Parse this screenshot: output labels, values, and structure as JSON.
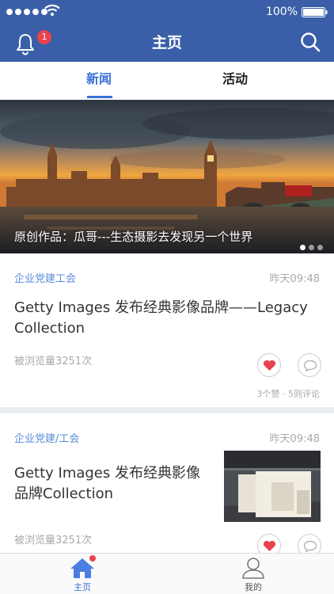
{
  "status_bar": {
    "battery_text": "100%",
    "signal_icon": "signal-dots-icon",
    "wifi_icon": "wifi-icon",
    "battery_icon": "battery-icon"
  },
  "nav": {
    "title": "主页",
    "notification_count": "1",
    "left_icon": "bell-icon",
    "right_icon": "search-icon"
  },
  "tabs": [
    {
      "label": "新闻",
      "active": true
    },
    {
      "label": "活动",
      "active": false
    }
  ],
  "banner": {
    "caption": "原创作品：瓜哥---生态摄影去发现另一个世界",
    "slide_count": 3,
    "active_slide": 1
  },
  "articles": [
    {
      "category": "企业党建工会",
      "time": "昨天09:48",
      "title": "Getty Images 发布经典影像品牌——Legacy Collection",
      "views": "被浏览量3251次",
      "stats": "3个赞 · 5则评论"
    },
    {
      "category": "企业党建/工会",
      "time": "昨天09:48",
      "title": "Getty Images 发布经典影像品牌Collection",
      "views": "被浏览量3251次"
    }
  ],
  "tabbar": [
    {
      "label": "主页",
      "icon": "home-icon",
      "active": true
    },
    {
      "label": "我的",
      "icon": "user-icon",
      "active": false
    }
  ],
  "colors": {
    "header_bg": "#3a5fa8",
    "accent": "#3a6fd8",
    "badge": "#e8434f",
    "like": "#e8434f"
  }
}
